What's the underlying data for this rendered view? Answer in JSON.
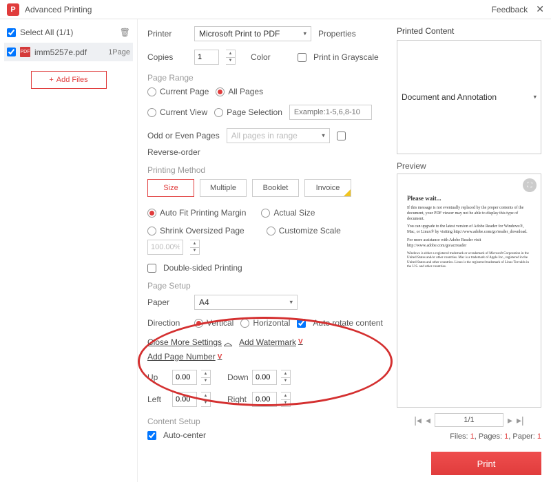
{
  "titlebar": {
    "app_initial": "P",
    "title": "Advanced Printing",
    "feedback": "Feedback"
  },
  "sidebar": {
    "select_all": "Select All (1/1)",
    "files": [
      {
        "name": "imm5257e.pdf",
        "pages": "1Page"
      }
    ],
    "add_files": "Add Files"
  },
  "printer": {
    "label": "Printer",
    "selected": "Microsoft Print to PDF",
    "properties": "Properties",
    "copies_label": "Copies",
    "copies_value": "1",
    "color_label": "Color",
    "grayscale": "Print in Grayscale"
  },
  "page_range": {
    "section": "Page Range",
    "current_page": "Current Page",
    "all_pages": "All Pages",
    "current_view": "Current View",
    "page_selection": "Page Selection",
    "placeholder": "Example:1-5,6,8-10",
    "odd_even_label": "Odd or Even Pages",
    "odd_even_value": "All pages in range",
    "reverse": "Reverse-order"
  },
  "method": {
    "section": "Printing Method",
    "size": "Size",
    "multiple": "Multiple",
    "booklet": "Booklet",
    "invoice": "Invoice",
    "auto_fit": "Auto Fit Printing Margin",
    "actual": "Actual Size",
    "shrink": "Shrink Oversized Page",
    "scale": "Customize Scale",
    "scale_val": "100.00%",
    "double_sided": "Double-sided Printing"
  },
  "page_setup": {
    "section": "Page Setup",
    "paper_label": "Paper",
    "paper_value": "A4",
    "direction_label": "Direction",
    "vertical": "Vertical",
    "horizontal": "Horizontal",
    "auto_rotate": "Auto rotate content",
    "close_more": "Close More Settings",
    "add_watermark": "Add Watermark",
    "add_pagenum": "Add Page Number",
    "up": "Up",
    "down": "Down",
    "left": "Left",
    "right": "Right",
    "margin_val": "0.00"
  },
  "content_setup": {
    "section": "Content Setup",
    "auto_center": "Auto-center"
  },
  "right": {
    "printed_content": "Printed Content",
    "printed_content_value": "Document and Annotation",
    "preview_label": "Preview",
    "preview": {
      "h": "Please wait...",
      "p1": "If this message is not eventually replaced by the proper contents of the document, your PDF viewer may not be able to display this type of document.",
      "p2": "You can upgrade to the latest version of Adobe Reader for Windows®, Mac, or Linux® by visiting http://www.adobe.com/go/reader_download.",
      "p3": "For more assistance with Adobe Reader visit http://www.adobe.com/go/acrreader",
      "p4": "Windows is either a registered trademark or a trademark of Microsoft Corporation in the United States and/or other countries. Mac is a trademark of Apple Inc., registered in the United States and other countries. Linux is the registered trademark of Linus Torvalds in the U.S. and other countries."
    },
    "page_display": "1/1",
    "counts_pre1": "Files: ",
    "counts_v1": "1",
    "counts_pre2": ", Pages: ",
    "counts_v2": "1",
    "counts_pre3": ", Paper: ",
    "counts_v3": "1",
    "print": "Print"
  }
}
